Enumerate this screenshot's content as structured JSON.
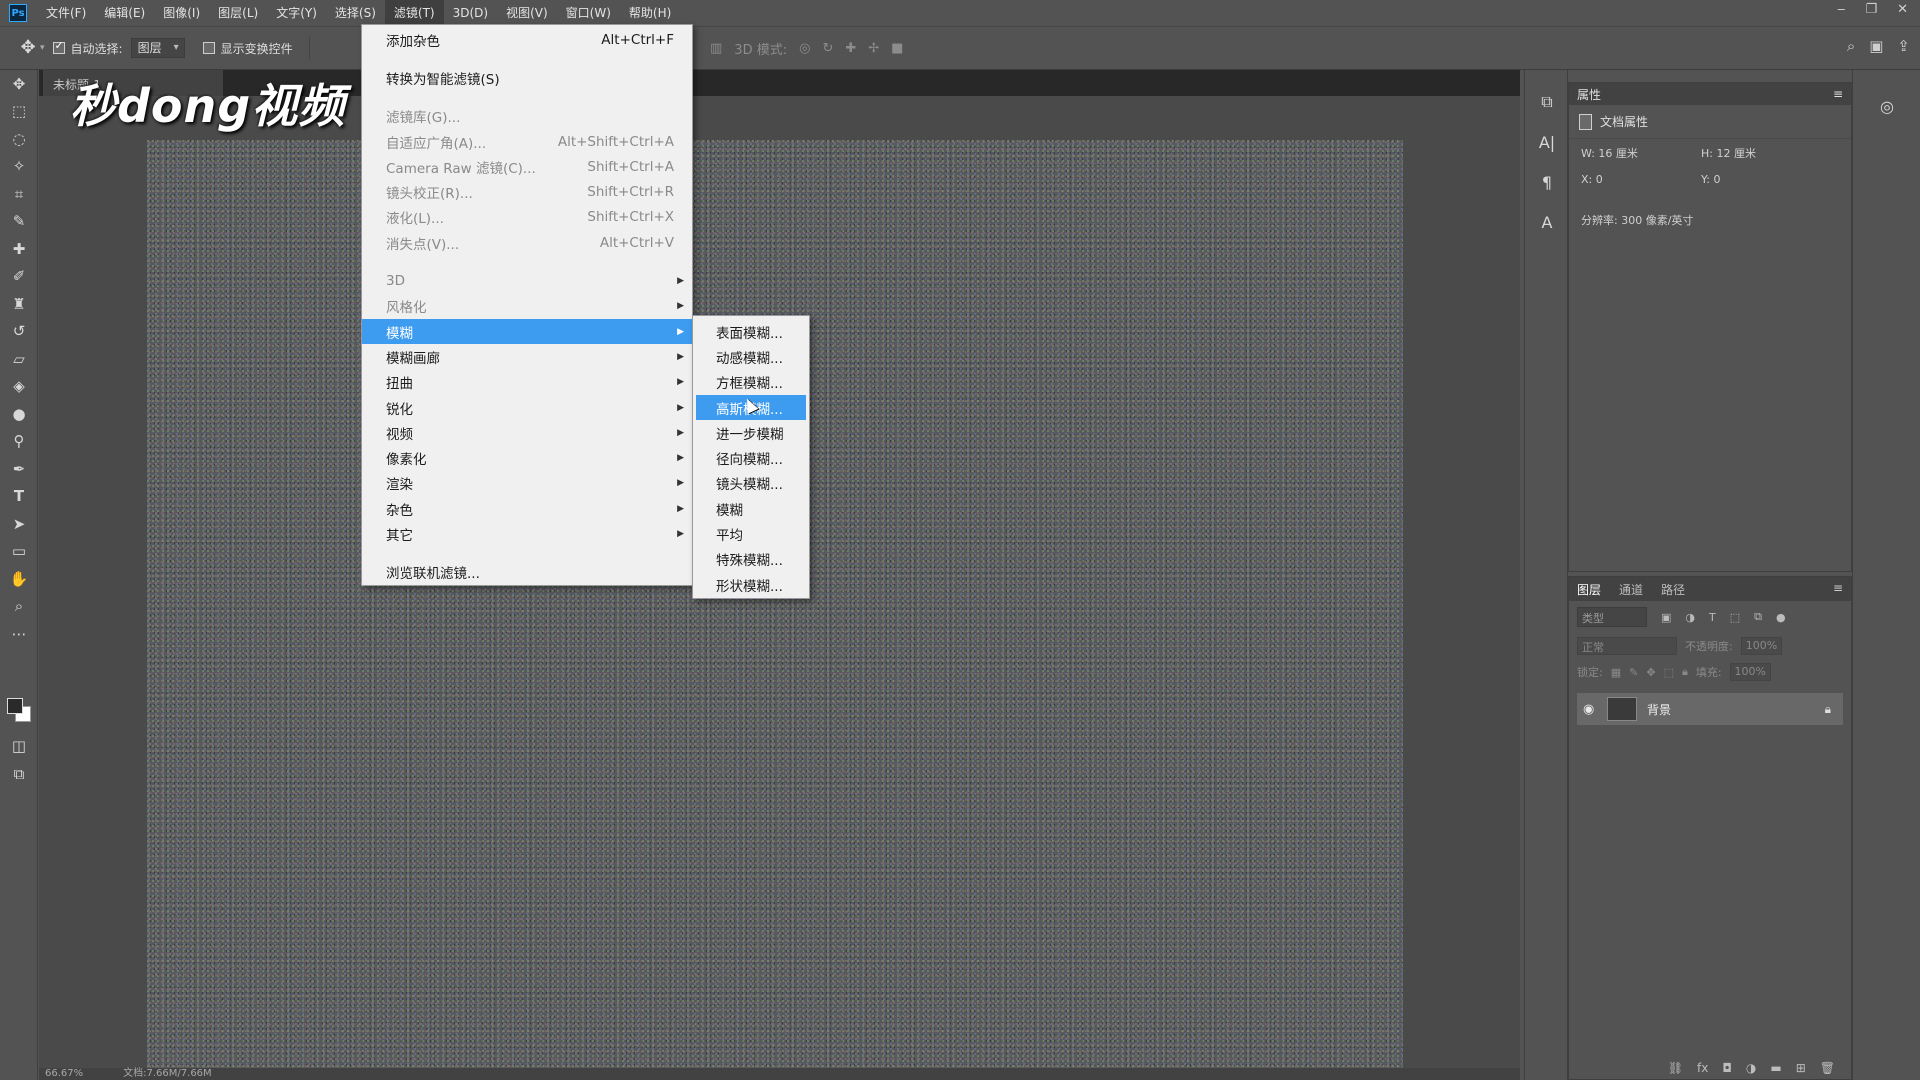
{
  "menubar": {
    "logo": "Ps",
    "items": [
      "文件(F)",
      "编辑(E)",
      "图像(I)",
      "图层(L)",
      "文字(Y)",
      "选择(S)",
      "滤镜(T)",
      "3D(D)",
      "视图(V)",
      "窗口(W)",
      "帮助(H)"
    ],
    "active_index": 6
  },
  "options_bar": {
    "auto_select_label": "自动选择:",
    "auto_select_checked": true,
    "auto_select_target": "图层",
    "show_transform_label": "显示变换控件",
    "show_transform_checked": false,
    "mode_3d_label": "3D 模式:"
  },
  "document": {
    "tab_label": "未标题-1",
    "watermark": "秒dong视频",
    "status_zoom": "66.67%",
    "status_doc": "文档:7.66M/7.66M"
  },
  "filter_menu": {
    "items": [
      {
        "label": "添加杂色",
        "shortcut": "Alt+Ctrl+F",
        "disabled": false
      },
      {
        "gap": true
      },
      {
        "label": "转换为智能滤镜(S)",
        "shortcut": "",
        "disabled": false
      },
      {
        "gap": true
      },
      {
        "label": "滤镜库(G)...",
        "shortcut": "",
        "disabled": true
      },
      {
        "label": "自适应广角(A)...",
        "shortcut": "Alt+Shift+Ctrl+A",
        "disabled": true
      },
      {
        "label": "Camera Raw 滤镜(C)...",
        "shortcut": "Shift+Ctrl+A",
        "disabled": true
      },
      {
        "label": "镜头校正(R)...",
        "shortcut": "Shift+Ctrl+R",
        "disabled": true
      },
      {
        "label": "液化(L)...",
        "shortcut": "Shift+Ctrl+X",
        "disabled": true
      },
      {
        "label": "消失点(V)...",
        "shortcut": "Alt+Ctrl+V",
        "disabled": true
      },
      {
        "gap": true
      },
      {
        "label": "3D",
        "submenu": true,
        "disabled": true
      },
      {
        "label": "风格化",
        "submenu": true,
        "disabled": true
      },
      {
        "label": "模糊",
        "submenu": true,
        "highlight": true
      },
      {
        "label": "模糊画廊",
        "submenu": true
      },
      {
        "label": "扭曲",
        "submenu": true
      },
      {
        "label": "锐化",
        "submenu": true
      },
      {
        "label": "视频",
        "submenu": true
      },
      {
        "label": "像素化",
        "submenu": true
      },
      {
        "label": "渲染",
        "submenu": true
      },
      {
        "label": "杂色",
        "submenu": true
      },
      {
        "label": "其它",
        "submenu": true
      },
      {
        "gap": true
      },
      {
        "label": "浏览联机滤镜...",
        "shortcut": ""
      }
    ]
  },
  "blur_submenu": {
    "items": [
      "表面模糊...",
      "动感模糊...",
      "方框模糊...",
      "高斯模糊...",
      "进一步模糊",
      "径向模糊...",
      "镜头模糊...",
      "模糊",
      "平均",
      "特殊模糊...",
      "形状模糊..."
    ],
    "highlight_index": 3
  },
  "properties_panel": {
    "tab": "属性",
    "title": "文档属性",
    "width": "W: 16 厘米",
    "height": "H: 12 厘米",
    "x": "X: 0",
    "y": "Y: 0",
    "resolution": "分辨率: 300 像素/英寸"
  },
  "layers_panel": {
    "tabs": [
      "图层",
      "通道",
      "路径"
    ],
    "filter_placeholder": "类型",
    "blend_mode": "正常",
    "opacity_label": "不透明度:",
    "opacity_value": "100%",
    "lock_label": "锁定:",
    "fill_label": "填充:",
    "fill_value": "100%",
    "layer_name": "背景"
  },
  "colors": {
    "highlight": "#3d9bf0",
    "ui_gray": "#535353"
  }
}
